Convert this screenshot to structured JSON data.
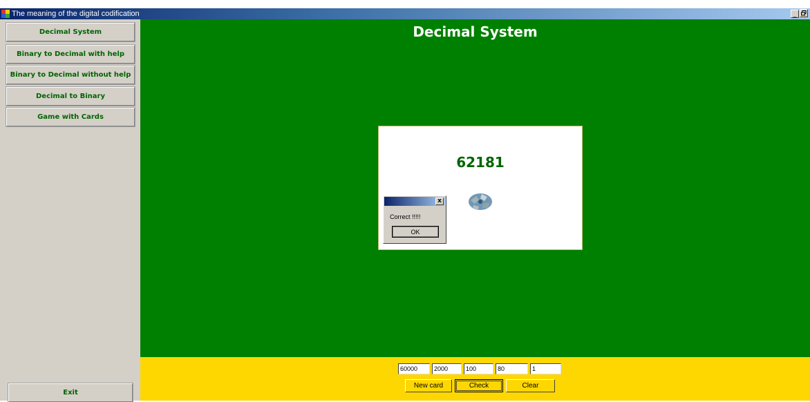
{
  "window": {
    "title": "The meaning of the digital codification",
    "minimize_label": "_",
    "restore_label": "Ɖ"
  },
  "sidebar": {
    "items": [
      {
        "label": "Decimal System"
      },
      {
        "label": "Binary to Decimal with help"
      },
      {
        "label": "Binary to Decimal without help"
      },
      {
        "label": "Decimal to Binary"
      },
      {
        "label": "Game with Cards"
      }
    ],
    "exit_label": "Exit"
  },
  "main": {
    "heading": "Decimal System",
    "card_number": "62181"
  },
  "dialog": {
    "close_label": "x",
    "message": "Correct !!!!!",
    "ok_label": "OK"
  },
  "inputs": {
    "values": [
      "60000",
      "2000",
      "100",
      "80",
      "1"
    ]
  },
  "actions": {
    "new_card": "New card",
    "check": "Check",
    "clear": "Clear"
  },
  "colors": {
    "main_background": "#008000",
    "bottom_bar": "#ffd700",
    "sidebar": "#d4d0c8",
    "nav_text": "#006400"
  }
}
